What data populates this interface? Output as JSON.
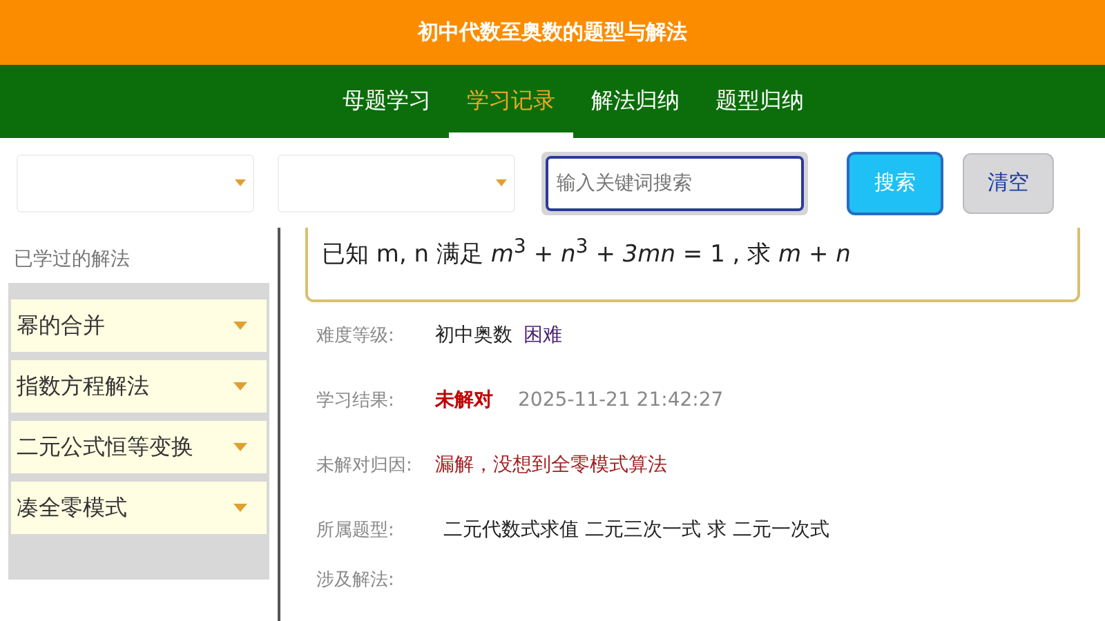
{
  "app_title": "初中代数至奥数的题型与解法",
  "tabs": [
    {
      "label": "母题学习",
      "selected": false
    },
    {
      "label": "学习记录",
      "selected": true
    },
    {
      "label": "解法归纳",
      "selected": false
    },
    {
      "label": "题型归纳",
      "selected": false
    }
  ],
  "filters": {
    "search": {
      "placeholder": "输入关键词搜索"
    },
    "buttons": [
      {
        "label": "搜索",
        "kind": "primary"
      },
      {
        "label": "清空",
        "kind": "secondary"
      }
    ]
  },
  "sidebar": {
    "title": "已学过的解法",
    "items": [
      {
        "label": "幂的合并",
        "expanded": false
      },
      {
        "label": "指数方程解法",
        "expanded": false
      },
      {
        "label": "二元公式恒等变换",
        "expanded": false
      },
      {
        "label": "凑全零模式",
        "expanded": false
      }
    ]
  },
  "question": "已知 m, n 满足 *m*$^{3}$ + *n*$^{3}$ + *3mn* = 1 , 求 *m* + *n*",
  "details": [
    {
      "label": "难度等级:",
      "kind": "level",
      "values": [
        "初中奥数",
        "困难"
      ]
    },
    {
      "label": "学习结果:",
      "kind": "result",
      "values": [
        "未解对",
        "2025-11-21 21:42:27"
      ]
    },
    {
      "label": "未解对归因:",
      "kind": "cause",
      "values": [
        "漏解，没想到全零模式算法"
      ]
    },
    {
      "label": "所属题型:",
      "kind": "type",
      "values": [
        "二元代数式求值  二元三次一式 求 二元一次式"
      ]
    },
    {
      "label": "涉及解法:",
      "kind": "methods"
    }
  ]
}
